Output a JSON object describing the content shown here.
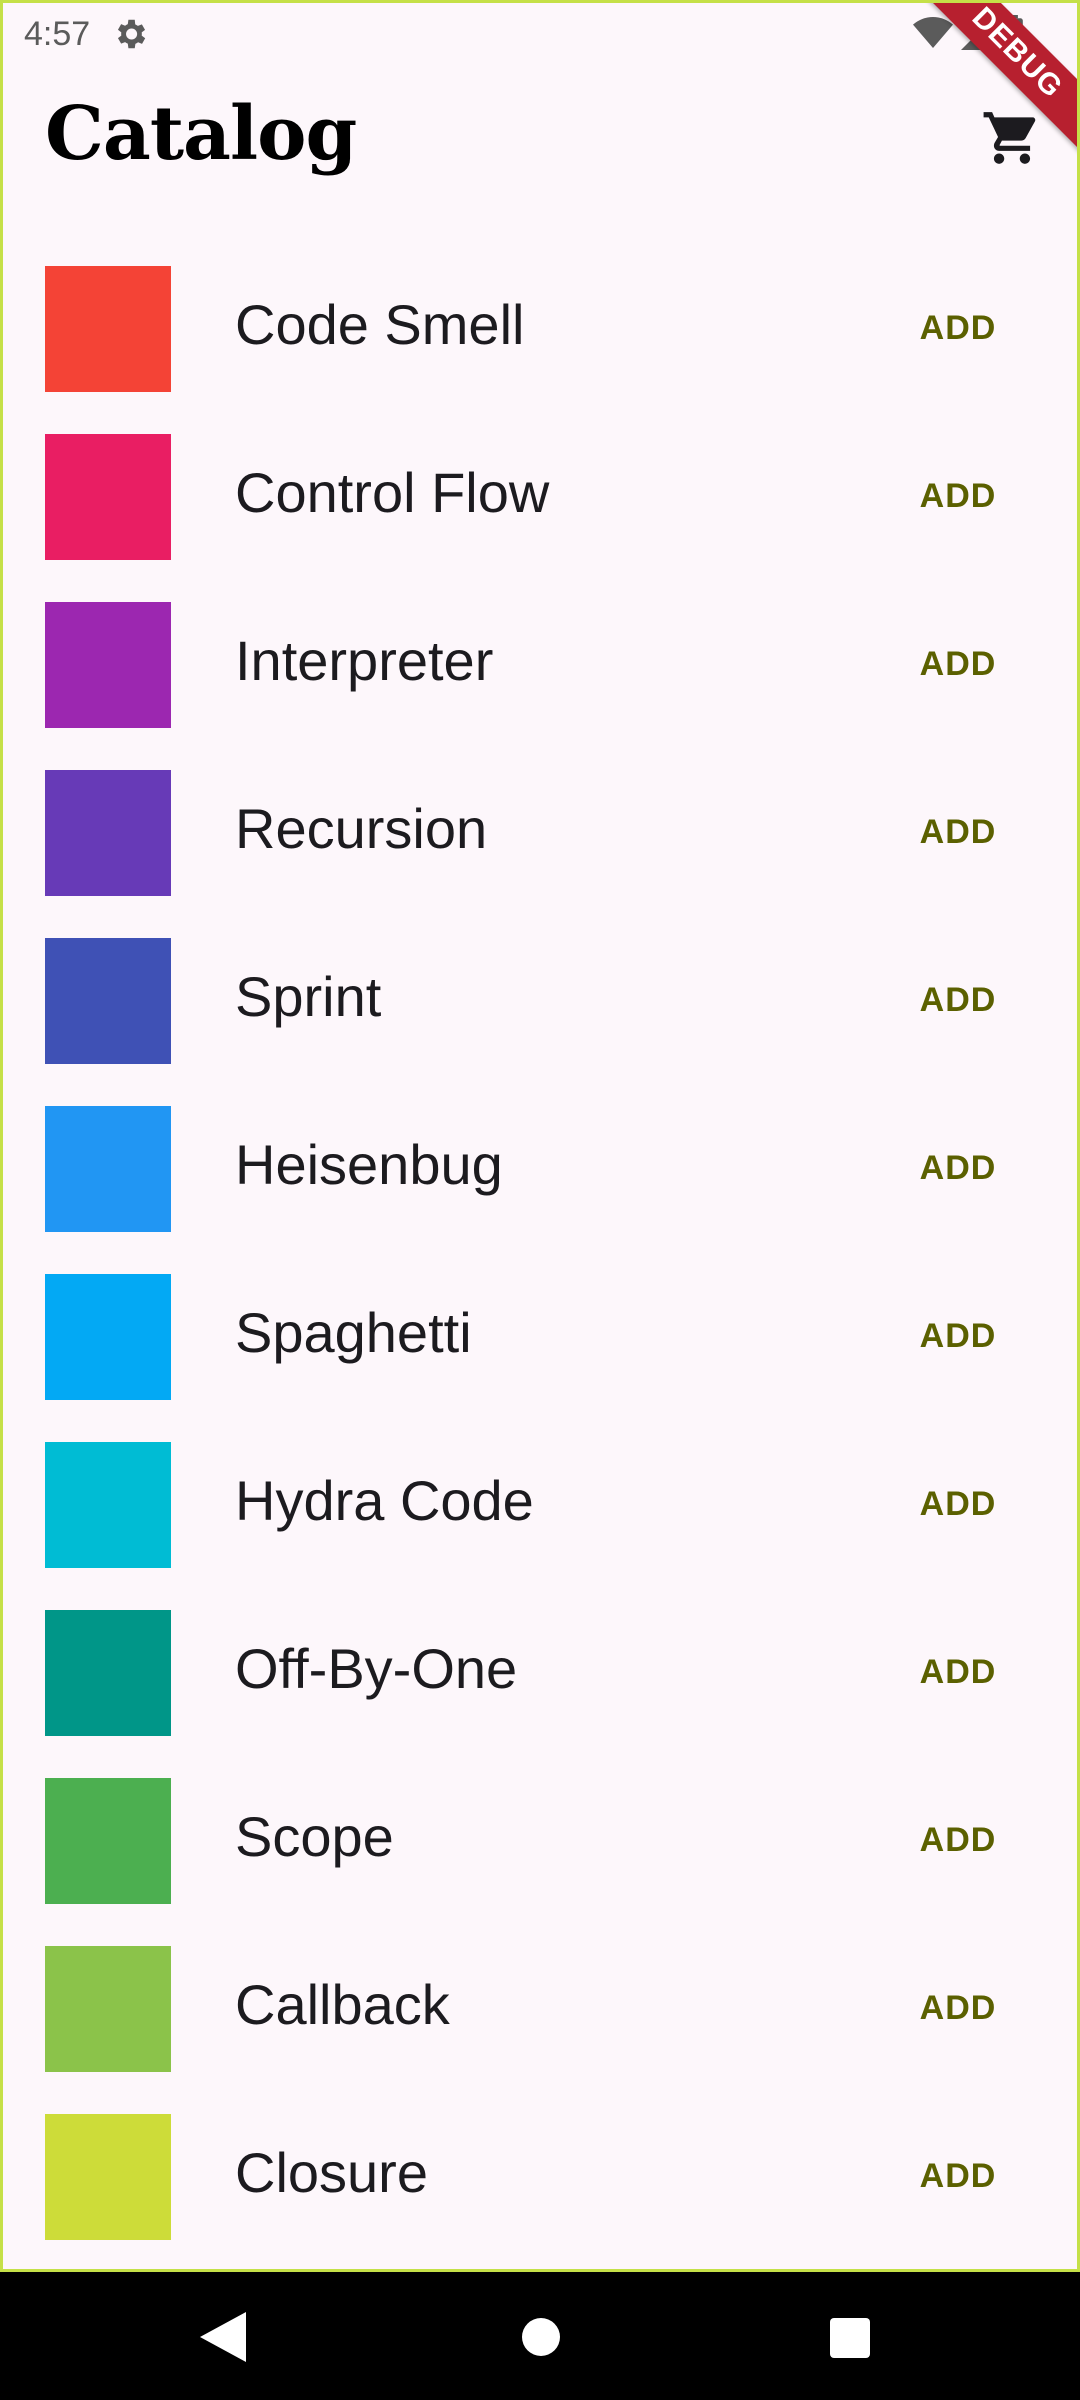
{
  "status_bar": {
    "time": "4:57",
    "icons": [
      "settings-gear-icon",
      "wifi-icon",
      "cell-signal-icon",
      "battery-icon"
    ]
  },
  "debug_banner": {
    "label": "DEBUG",
    "color": "#b7202f"
  },
  "app_bar": {
    "title": "Catalog",
    "cart_icon": "shopping-cart-icon"
  },
  "catalog": {
    "items": [
      {
        "name": "Code Smell",
        "color": "#f44336",
        "action": "ADD"
      },
      {
        "name": "Control Flow",
        "color": "#e91e63",
        "action": "ADD"
      },
      {
        "name": "Interpreter",
        "color": "#9c27b0",
        "action": "ADD"
      },
      {
        "name": "Recursion",
        "color": "#673ab7",
        "action": "ADD"
      },
      {
        "name": "Sprint",
        "color": "#3f51b5",
        "action": "ADD"
      },
      {
        "name": "Heisenbug",
        "color": "#2196f3",
        "action": "ADD"
      },
      {
        "name": "Spaghetti",
        "color": "#03a9f4",
        "action": "ADD"
      },
      {
        "name": "Hydra Code",
        "color": "#00bcd4",
        "action": "ADD"
      },
      {
        "name": "Off-By-One",
        "color": "#009688",
        "action": "ADD"
      },
      {
        "name": "Scope",
        "color": "#4caf50",
        "action": "ADD"
      },
      {
        "name": "Callback",
        "color": "#8bc34a",
        "action": "ADD"
      },
      {
        "name": "Closure",
        "color": "#cddc39",
        "action": "ADD"
      }
    ]
  },
  "nav_bar": {
    "buttons": [
      "back-icon",
      "home-icon",
      "recents-icon"
    ]
  }
}
